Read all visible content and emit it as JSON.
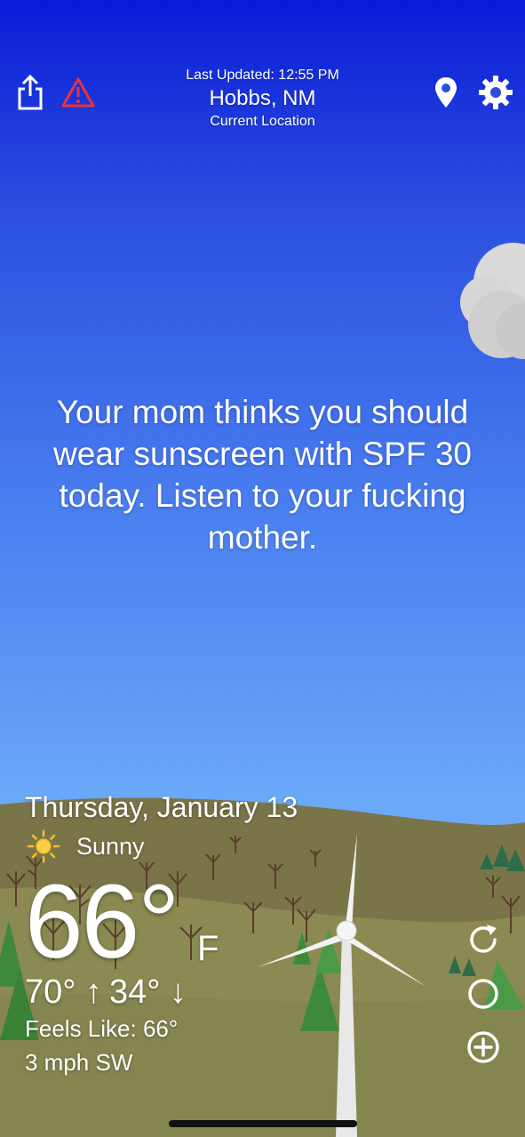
{
  "header": {
    "last_updated": "Last Updated: 12:55 PM",
    "city": "Hobbs, NM",
    "location_label": "Current Location"
  },
  "icons": {
    "share": "share-icon",
    "alert": "warning-triangle-icon",
    "location": "location-pin-icon",
    "settings": "gear-icon",
    "refresh": "refresh-icon",
    "theme": "moon-toggle-icon",
    "add": "add-circle-icon",
    "condition": "sun-icon"
  },
  "message": "Your mom thinks you should wear sunscreen with SPF 30 today. Listen to your fucking mother.",
  "weather": {
    "date": "Thursday, January 13",
    "condition": "Sunny",
    "temperature": "66°",
    "unit": "F",
    "high": "70° ↑",
    "low": "34° ↓",
    "feels_like": "Feels Like: 66°",
    "wind": "3 mph SW"
  },
  "colors": {
    "sky_top": "#0a1bd6",
    "sky_bottom": "#7ab8fb",
    "alert_red": "#e8333a",
    "hill": "#8a8a52",
    "tree_green": "#3d8a3a"
  }
}
